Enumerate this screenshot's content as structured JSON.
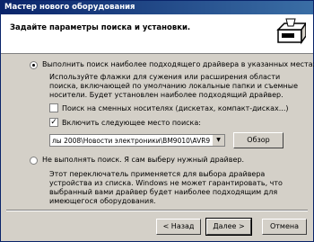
{
  "window": {
    "title": "Мастер нового оборудования"
  },
  "header": {
    "title": "Задайте параметры поиска и установки."
  },
  "options": {
    "search": {
      "label": "Выполнить поиск наиболее подходящего драйвера в указанных местах.",
      "description": "Используйте флажки для сужения или расширения области поиска, включающей по умолчанию локальные папки и съемные носители. Будет установлен наиболее подходящий драйвер.",
      "removable_label": "Поиск на сменных носителях (дискетах, компакт-дисках...)",
      "include_label": "Включить следующее место поиска:",
      "path_value": "лы 2008\\Новости электроники\\BM9010\\AVR910",
      "browse_label": "Обзор"
    },
    "manual": {
      "label": "Не выполнять поиск. Я сам выберу нужный драйвер.",
      "description": "Этот переключатель применяется для выбора драйвера устройства из списка. Windows не может гарантировать, что выбранный вами драйвер будет наиболее подходящим для имеющегося оборудования."
    }
  },
  "buttons": {
    "back": "< Назад",
    "next": "Далее >",
    "cancel": "Отмена"
  }
}
